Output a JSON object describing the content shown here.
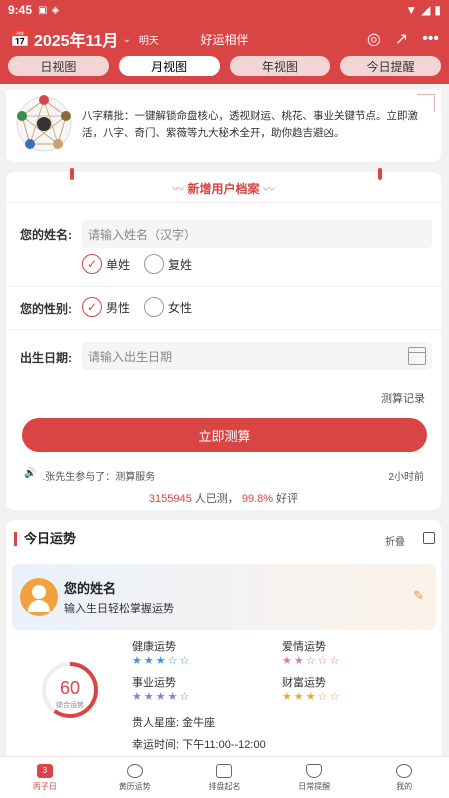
{
  "status_bar": {
    "time": "9:45"
  },
  "header": {
    "date_title": "2025年11月",
    "tomorrow": "明天",
    "center_title": "好运相伴",
    "tabs": [
      "日视图",
      "月视图",
      "年视图",
      "今日提醒"
    ],
    "active_tab_index": 1,
    "accent_color": "#d94545"
  },
  "intro": {
    "text": "八字精批：一键解锁命盘核心，透视财运、桃花、事业关键节点。立即激活，八字、奇门、紫薇等九大秘术全开，助你趋吉避凶。"
  },
  "form": {
    "title": "新增用户档案",
    "name_label": "您的姓名:",
    "name_placeholder": "请输入姓名（汉字）",
    "surname_options": [
      "单姓",
      "复姓"
    ],
    "gender_label": "您的性别:",
    "gender_options": [
      "男性",
      "女性"
    ],
    "birth_label": "出生日期:",
    "birth_placeholder": "请输入出生日期",
    "record_link": "测算记录",
    "submit_label": "立即测算",
    "notice_text": ".张先生参与了：测算服务",
    "notice_time": "2小时前",
    "stats_count": "3155945",
    "stats_mid": " 人已测， ",
    "stats_rate": "99.8%",
    "stats_tail": " 好评"
  },
  "fortune": {
    "title": "今日运势",
    "fold_label": "折叠",
    "profile_name": "您的姓名",
    "profile_sub": "输入生日轻松掌握运势",
    "score": "60",
    "score_label": "综合运势",
    "score_value": 60,
    "items": [
      {
        "label": "健康运势",
        "stars": 3,
        "color": "#4a90e2"
      },
      {
        "label": "爱情运势",
        "stars": 2,
        "color": "#e07aa6"
      },
      {
        "label": "事业运势",
        "stars": 4,
        "color": "#8b7fd6"
      },
      {
        "label": "财富运势",
        "stars": 3,
        "color": "#e8a93a"
      }
    ],
    "noble_label": "贵人星座:",
    "noble_value": "金牛座",
    "lucky_label": "幸运时间:",
    "lucky_value": "下午11:00--12:00"
  },
  "bottom_nav": {
    "items": [
      "丙子日",
      "黄历运势",
      "排盘起名",
      "日常提醒",
      "我的"
    ],
    "active_index": 0,
    "active_badge": "3"
  }
}
